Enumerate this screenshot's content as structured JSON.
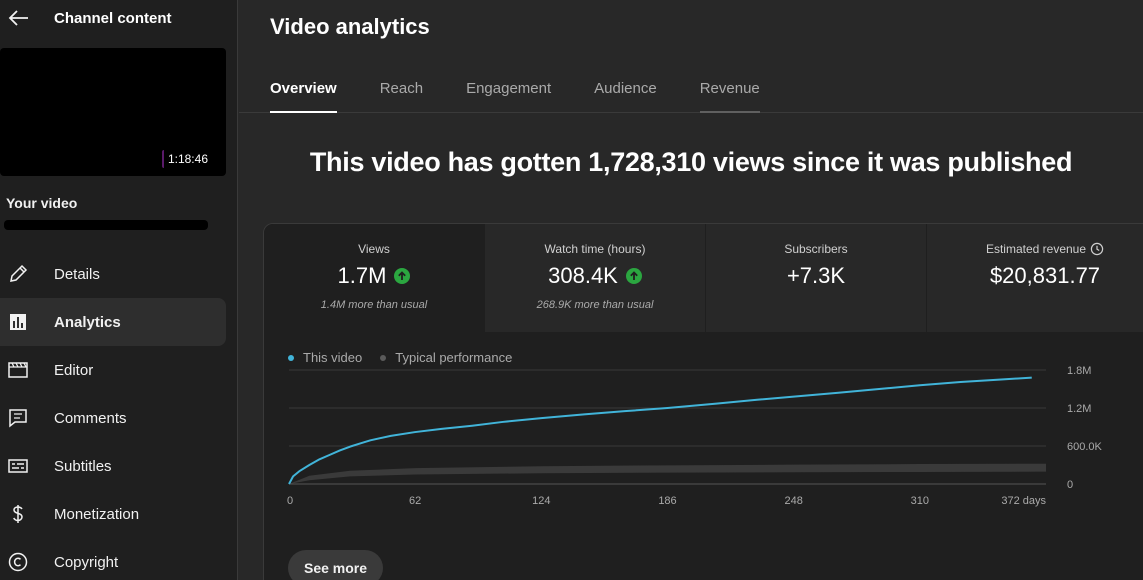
{
  "sidebar": {
    "title": "Channel content",
    "duration": "1:18:46",
    "your_video": "Your video",
    "items": [
      {
        "label": "Details",
        "icon": "pencil-icon"
      },
      {
        "label": "Analytics",
        "icon": "analytics-icon",
        "active": true
      },
      {
        "label": "Editor",
        "icon": "clapper-icon"
      },
      {
        "label": "Comments",
        "icon": "comment-icon"
      },
      {
        "label": "Subtitles",
        "icon": "subtitles-icon"
      },
      {
        "label": "Monetization",
        "icon": "dollar-icon"
      },
      {
        "label": "Copyright",
        "icon": "copyright-icon"
      }
    ]
  },
  "main": {
    "title": "Video analytics",
    "tabs": [
      "Overview",
      "Reach",
      "Engagement",
      "Audience",
      "Revenue"
    ],
    "active_tab": "Overview",
    "headline": "This video has gotten 1,728,310 views since it was published",
    "metrics": [
      {
        "label": "Views",
        "value": "1.7M",
        "sub": "1.4M more than usual",
        "trend": "up"
      },
      {
        "label": "Watch time (hours)",
        "value": "308.4K",
        "sub": "268.9K more than usual",
        "trend": "up"
      },
      {
        "label": "Subscribers",
        "value": "+7.3K",
        "sub": ""
      },
      {
        "label": "Estimated revenue",
        "value": "$20,831.77",
        "sub": ""
      }
    ],
    "see_more": "See more"
  },
  "colors": {
    "accent_line": "#41b4d9",
    "typical_band": "#3a3a3a",
    "up_green": "#2ba640"
  },
  "chart_data": {
    "type": "line",
    "legend": [
      "This video",
      "Typical performance"
    ],
    "x_ticks": [
      "0",
      "62",
      "124",
      "186",
      "248",
      "310",
      "372 days"
    ],
    "y_ticks": [
      "0",
      "600.0K",
      "1.2M",
      "1.8M"
    ],
    "xlim": [
      0,
      372
    ],
    "ylim": [
      0,
      1800000
    ],
    "series": [
      {
        "name": "This video",
        "x": [
          0,
          2,
          5,
          10,
          15,
          20,
          25,
          30,
          35,
          40,
          50,
          62,
          75,
          90,
          105,
          124,
          145,
          165,
          186,
          210,
          230,
          248,
          270,
          290,
          310,
          330,
          350,
          365
        ],
        "y": [
          0,
          120000,
          200000,
          300000,
          390000,
          460000,
          530000,
          590000,
          640000,
          690000,
          760000,
          820000,
          870000,
          920000,
          980000,
          1040000,
          1100000,
          1150000,
          1200000,
          1270000,
          1330000,
          1380000,
          1440000,
          1500000,
          1560000,
          1610000,
          1650000,
          1680000
        ]
      },
      {
        "name": "Typical performance",
        "x": [
          0,
          10,
          30,
          62,
          124,
          186,
          248,
          310,
          372
        ],
        "low": [
          0,
          60000,
          120000,
          150000,
          170000,
          180000,
          185000,
          190000,
          195000
        ],
        "high": [
          0,
          130000,
          210000,
          250000,
          280000,
          295000,
          305000,
          315000,
          320000
        ]
      }
    ]
  }
}
